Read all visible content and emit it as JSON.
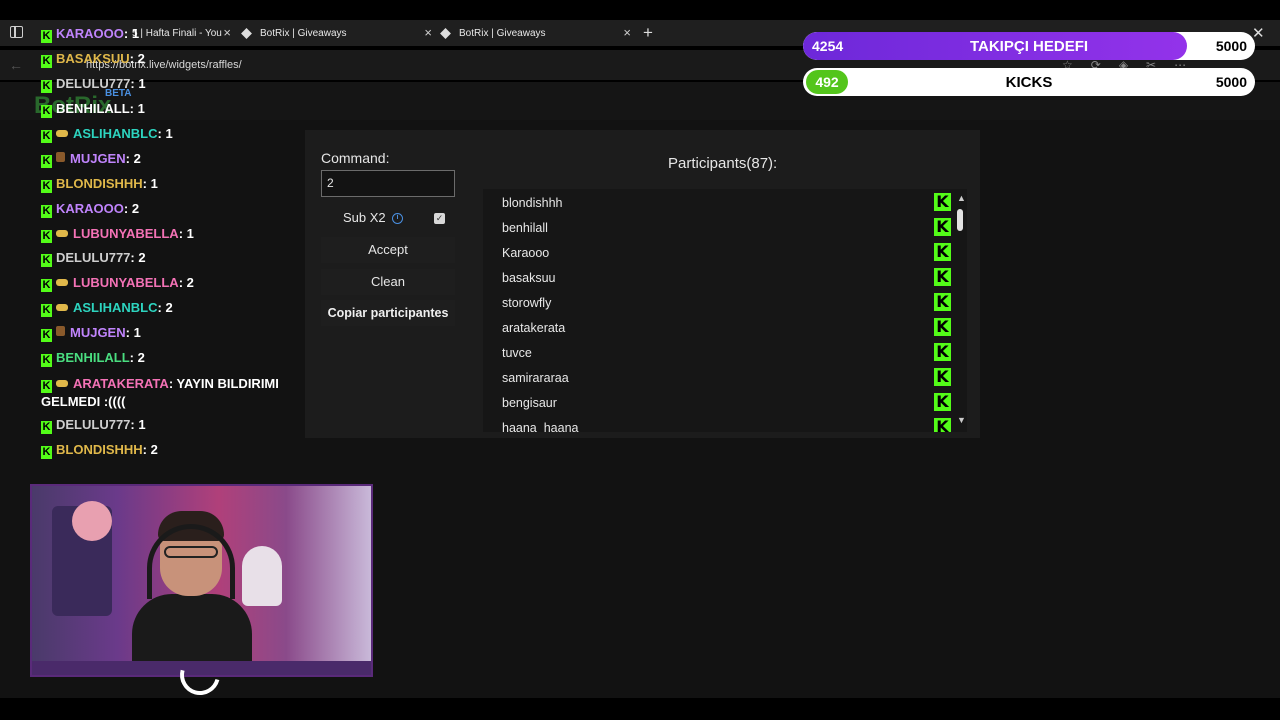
{
  "browser": {
    "tabs": [
      {
        "label": "5 | Hafta Finali - You"
      },
      {
        "label": "BotRix | Giveaways"
      },
      {
        "label": "BotRix | Giveaways"
      }
    ],
    "url": "https://botrix.live/widgets/raffles/"
  },
  "site": {
    "logo": "BotRix",
    "beta": "BETA"
  },
  "raffle": {
    "command_label": "Command:",
    "command_value": "2",
    "sub_label": "Sub X2",
    "sub_checked": true,
    "accept_label": "Accept",
    "clean_label": "Clean",
    "copy_label": "Copiar participantes",
    "participants_title": "Participants(87):",
    "participants": [
      "blondishhh",
      "benhilall",
      "Karaooo",
      "basaksuu",
      "storowfly",
      "aratakerata",
      "tuvce",
      "samirararaa",
      "bengisaur",
      "haana_haana"
    ]
  },
  "chat": [
    {
      "user": "KARAOOO",
      "msg": "1",
      "color": "#c084fc",
      "badge": "none"
    },
    {
      "user": "BASAKSUU",
      "msg": "2",
      "color": "#e0b84a",
      "badge": "none"
    },
    {
      "user": "DELULU777",
      "msg": "1",
      "color": "#cfcfcf",
      "badge": "none"
    },
    {
      "user": "BENHILALL",
      "msg": "1",
      "color": "#ffffff",
      "badge": "none"
    },
    {
      "user": "ASLIHANBLC",
      "msg": "1",
      "color": "#2dd4bf",
      "badge": "gold"
    },
    {
      "user": "MUJGEN",
      "msg": "2",
      "color": "#c084fc",
      "badge": "brown"
    },
    {
      "user": "BLONDISHHH",
      "msg": "1",
      "color": "#e0b84a",
      "badge": "none"
    },
    {
      "user": "KARAOOO",
      "msg": "2",
      "color": "#c084fc",
      "badge": "none"
    },
    {
      "user": "LUBUNYABELLA",
      "msg": "1",
      "color": "#f472b6",
      "badge": "gold"
    },
    {
      "user": "DELULU777",
      "msg": "2",
      "color": "#cfcfcf",
      "badge": "none"
    },
    {
      "user": "LUBUNYABELLA",
      "msg": "2",
      "color": "#f472b6",
      "badge": "gold"
    },
    {
      "user": "ASLIHANBLC",
      "msg": "2",
      "color": "#2dd4bf",
      "badge": "gold"
    },
    {
      "user": "MUJGEN",
      "msg": "1",
      "color": "#c084fc",
      "badge": "brown"
    },
    {
      "user": "BENHILALL",
      "msg": "2",
      "color": "#4ade80",
      "badge": "none"
    },
    {
      "user": "ARATAKERATA",
      "msg": "YAYIN BILDIRIMI GELMEDI :((((",
      "color": "#f472b6",
      "badge": "gold"
    },
    {
      "user": "DELULU777",
      "msg": "1",
      "color": "#cfcfcf",
      "badge": "none"
    },
    {
      "user": "BLONDISHHH",
      "msg": "2",
      "color": "#e0b84a",
      "badge": "none"
    }
  ],
  "goals": {
    "followers": {
      "current": "4254",
      "label": "TAKIPÇI HEDEFI",
      "target": "5000",
      "progress": 0.85
    },
    "kicks": {
      "current": "492",
      "label": "KICKS",
      "target": "5000",
      "progress": 0.098
    }
  },
  "colors": {
    "kick_green": "#53fc18",
    "goal_purple": "#7c2ff0"
  }
}
